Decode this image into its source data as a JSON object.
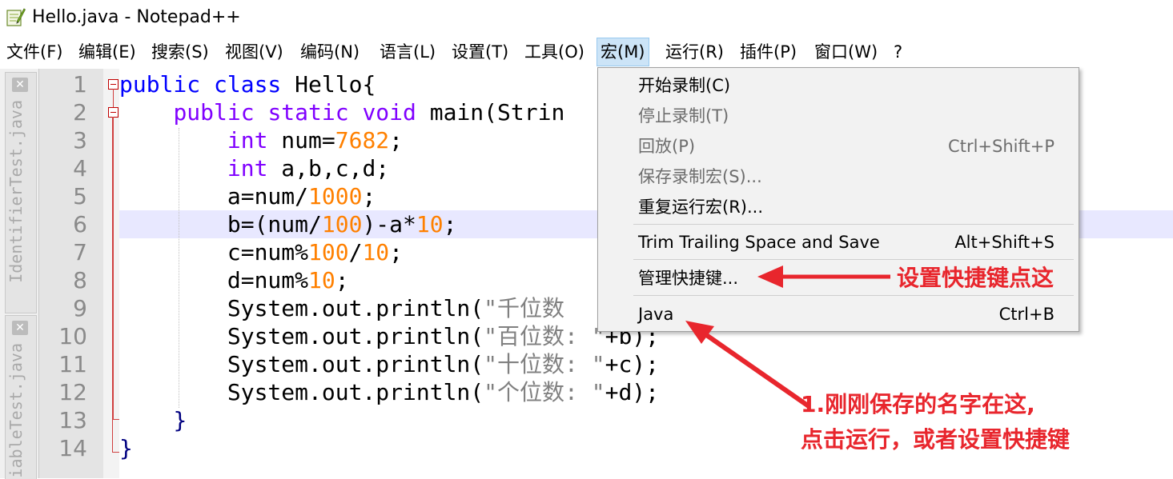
{
  "window": {
    "title": "Hello.java - Notepad++"
  },
  "menubar": [
    {
      "label": "文件(F)"
    },
    {
      "label": "编辑(E)"
    },
    {
      "label": "搜索(S)"
    },
    {
      "label": "视图(V)"
    },
    {
      "label": "编码(N)"
    },
    {
      "label": "语言(L)"
    },
    {
      "label": "设置(T)"
    },
    {
      "label": "工具(O)"
    },
    {
      "label": "宏(M)",
      "active": true
    },
    {
      "label": "运行(R)"
    },
    {
      "label": "插件(P)"
    },
    {
      "label": "窗口(W)"
    },
    {
      "label": "?"
    }
  ],
  "doc_tabs": [
    {
      "label": "IdentifierTest.java"
    },
    {
      "label": "iableTest.java"
    }
  ],
  "line_numbers": [
    "1",
    "2",
    "3",
    "4",
    "5",
    "6",
    "7",
    "8",
    "9",
    "10",
    "11",
    "12",
    "13",
    "14"
  ],
  "code": {
    "l1": {
      "kw": "public class",
      "rest": " Hello{"
    },
    "l2": {
      "kw": "public static void",
      "rest": " main(Strin"
    },
    "l3": {
      "kw": "int",
      "rest": " num=",
      "num": "7682",
      "end": ";"
    },
    "l4": {
      "kw": "int",
      "rest": " a,b,c,d;"
    },
    "l5": {
      "a": "a=num/",
      "num": "1000",
      "end": ";"
    },
    "l6": {
      "a": "b=(num/",
      "n1": "100",
      "b": ")-a*",
      "n2": "10",
      "end": ";"
    },
    "l7": {
      "a": "c=num%",
      "n1": "100",
      "b": "/",
      "n2": "10",
      "end": ";"
    },
    "l8": {
      "a": "d=num%",
      "num": "10",
      "end": ";"
    },
    "l9": {
      "a": "System.out.println(",
      "str": "\"千位数"
    },
    "l10": {
      "a": "System.out.println(",
      "str": "\"百位数: \"",
      "end": "+b);"
    },
    "l11": {
      "a": "System.out.println(",
      "str": "\"十位数: \"",
      "end": "+c);"
    },
    "l12": {
      "a": "System.out.println(",
      "str": "\"个位数: \"",
      "end": "+d);"
    },
    "l13": {
      "a": "}"
    },
    "l14": {
      "a": "}"
    }
  },
  "macro_menu": {
    "start": "开始录制(C)",
    "stop": "停止录制(T)",
    "playback": "回放(P)",
    "playback_shortcut": "Ctrl+Shift+P",
    "save": "保存录制宏(S)...",
    "repeat": "重复运行宏(R)...",
    "trim": "Trim Trailing Space and Save",
    "trim_shortcut": "Alt+Shift+S",
    "manage": "管理快捷键...",
    "java": "Java",
    "java_shortcut": "Ctrl+B"
  },
  "annotations": {
    "shortcut_hint": "设置快捷键点这",
    "saved_hint_line1": "1.刚刚保存的名字在这,",
    "saved_hint_line2": "点击运行，或者设置快捷键"
  },
  "colors": {
    "annotation_red": "#e8262d",
    "keyword_blue": "#0000ff",
    "type_purple": "#8000ff",
    "number_orange": "#ff8000",
    "string_gray": "#808080"
  }
}
